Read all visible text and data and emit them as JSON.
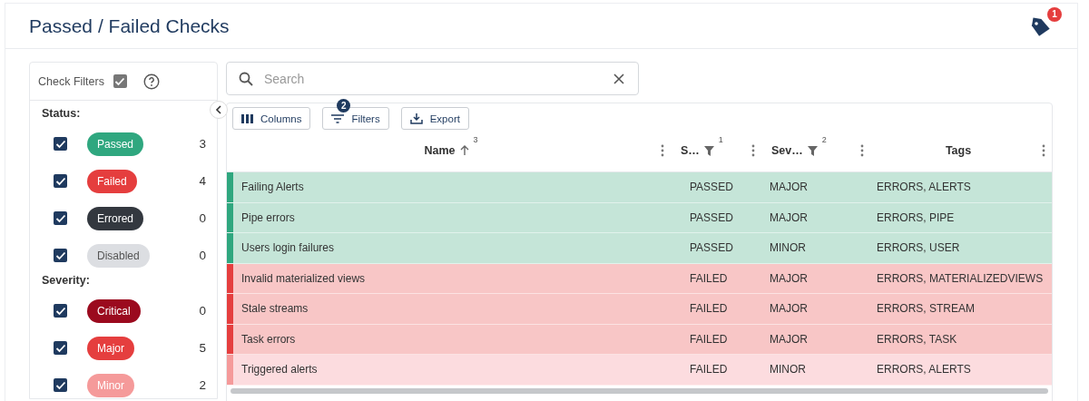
{
  "page": {
    "title": "Passed / Failed Checks",
    "notifications": "1"
  },
  "sidebar": {
    "title": "Check Filters",
    "all_checked": true,
    "sections": [
      {
        "heading": "Status:",
        "items": [
          {
            "label": "Passed",
            "count": "3",
            "checked": true,
            "color": "#2fa77f"
          },
          {
            "label": "Failed",
            "count": "4",
            "checked": true,
            "color": "#e53e3e"
          },
          {
            "label": "Errored",
            "count": "0",
            "checked": true,
            "color": "#33383f"
          },
          {
            "label": "Disabled",
            "count": "0",
            "checked": true,
            "color": "#dcdee2"
          }
        ]
      },
      {
        "heading": "Severity:",
        "items": [
          {
            "label": "Critical",
            "count": "0",
            "checked": true,
            "color": "#9b0a1e"
          },
          {
            "label": "Major",
            "count": "5",
            "checked": true,
            "color": "#e53e3e"
          },
          {
            "label": "Minor",
            "count": "2",
            "checked": true,
            "color": "#f59a9a"
          }
        ]
      }
    ]
  },
  "search": {
    "placeholder": "Search"
  },
  "toolbar": [
    {
      "kind": "columns",
      "label": "Columns"
    },
    {
      "kind": "filters",
      "label": "Filters",
      "badge": "2"
    },
    {
      "kind": "export",
      "label": "Export"
    }
  ],
  "table": {
    "columns": [
      {
        "label": "Name",
        "sort_ascending": true,
        "sort_index": "3"
      },
      {
        "label": "S…",
        "sort_index": "1",
        "filter": true
      },
      {
        "label": "Sev…",
        "sort_index": "2",
        "filter": true
      },
      {
        "label": "Tags"
      }
    ],
    "rows": [
      {
        "kind": "passed",
        "cells": [
          "Failing Alerts",
          "PASSED",
          "MAJOR",
          "ERRORS, ALERTS"
        ]
      },
      {
        "kind": "passed",
        "cells": [
          "Pipe errors",
          "PASSED",
          "MAJOR",
          "ERRORS, PIPE"
        ]
      },
      {
        "kind": "passed",
        "cells": [
          "Users login failures",
          "PASSED",
          "MINOR",
          "ERRORS, USER"
        ]
      },
      {
        "kind": "failed",
        "cells": [
          "Invalid materialized views",
          "FAILED",
          "MAJOR",
          "ERRORS, MATERIALIZEDVIEWS"
        ]
      },
      {
        "kind": "failed",
        "cells": [
          "Stale streams",
          "FAILED",
          "MAJOR",
          "ERRORS, STREAM"
        ]
      },
      {
        "kind": "failed",
        "cells": [
          "Task errors",
          "FAILED",
          "MAJOR",
          "ERRORS, TASK"
        ]
      },
      {
        "kind": "failed-minor",
        "cells": [
          "Triggered alerts",
          "FAILED",
          "MINOR",
          "ERRORS, ALERTS"
        ]
      }
    ]
  }
}
